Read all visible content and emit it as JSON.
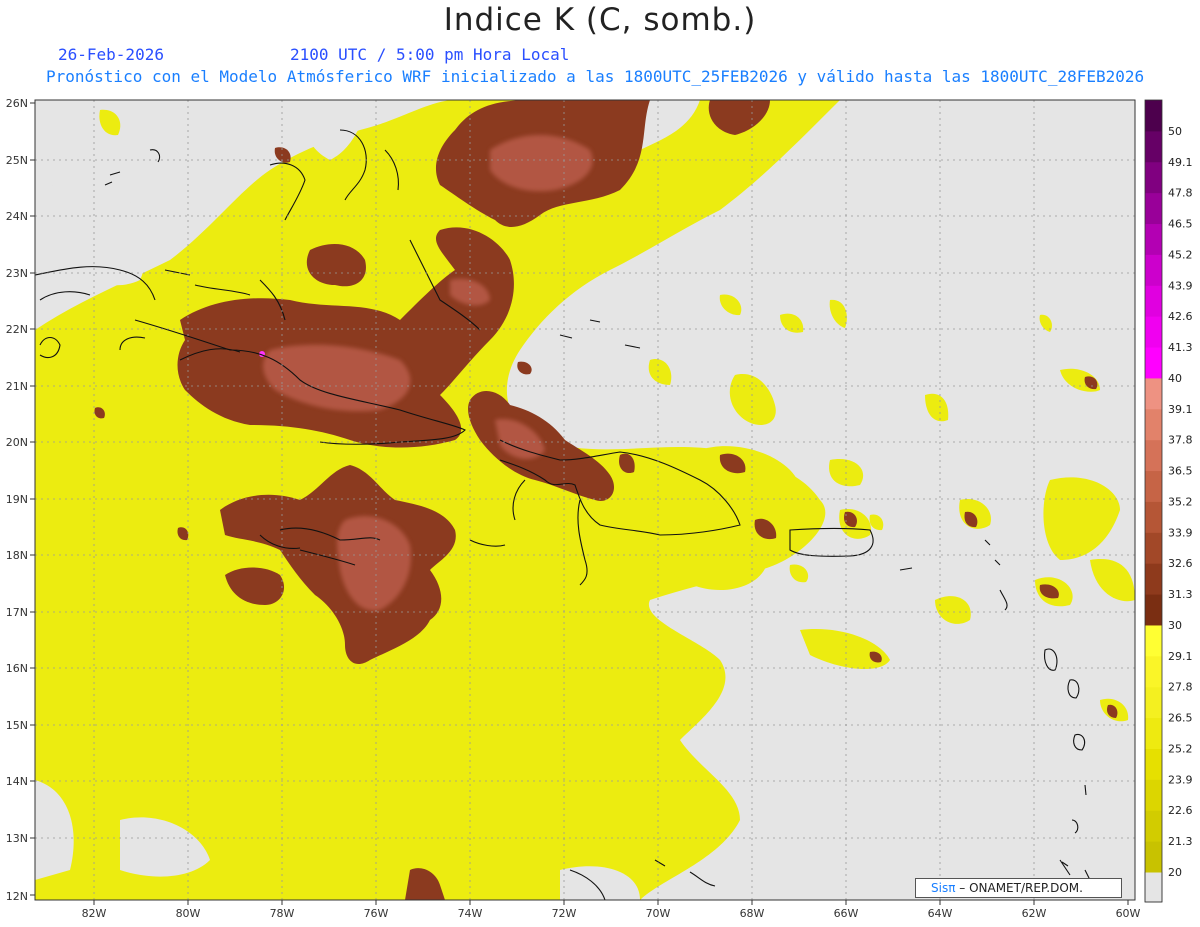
{
  "title": "Indice K (C, somb.)",
  "subtitle": {
    "date": "26-Feb-2026",
    "time": "2100 UTC / 5:00 pm Hora Local",
    "model": "Pronóstico con el Modelo Atmósferico WRF inicializado a las 1800UTC_25FEB2026 y válido hasta las  1800UTC_28FEB2026"
  },
  "axes": {
    "lat_labels": [
      "26N",
      "25N",
      "24N",
      "23N",
      "22N",
      "21N",
      "20N",
      "19N",
      "18N",
      "17N",
      "16N",
      "15N",
      "14N",
      "13N",
      "12N"
    ],
    "lon_labels": [
      "82W",
      "80W",
      "78W",
      "76W",
      "74W",
      "72W",
      "70W",
      "68W",
      "66W",
      "64W",
      "62W",
      "60W"
    ]
  },
  "colorbar": {
    "labels": [
      "20",
      "21.3",
      "22.6",
      "23.9",
      "25.2",
      "26.5",
      "27.8",
      "29.1",
      "30",
      "31.3",
      "32.6",
      "33.9",
      "35.2",
      "36.5",
      "37.8",
      "39.1",
      "40",
      "41.3",
      "42.6",
      "43.9",
      "45.2",
      "46.5",
      "47.8",
      "49.1",
      "50"
    ],
    "colors": [
      "#c8c200",
      "#d2cc00",
      "#dcd600",
      "#e6e000",
      "#eeea10",
      "#f4f020",
      "#faf528",
      "#ffff33",
      "#7a2e12",
      "#8e3a1c",
      "#a24828",
      "#b55636",
      "#c66446",
      "#d57258",
      "#e2826a",
      "#ee9282",
      "#ff00ff",
      "#f000f0",
      "#e000e0",
      "#cc00cc",
      "#b300b3",
      "#990099",
      "#800080",
      "#660066",
      "#4d004d"
    ],
    "top_label": "50"
  },
  "credit": {
    "brand": "Sisπ",
    "text": " – ONAMET/REP.DOM."
  },
  "colors": {
    "land_background": "#e5e5e5",
    "k_low": "#e8e800",
    "k_high": "#8b3a1f",
    "k_highlight": "#c06050"
  }
}
